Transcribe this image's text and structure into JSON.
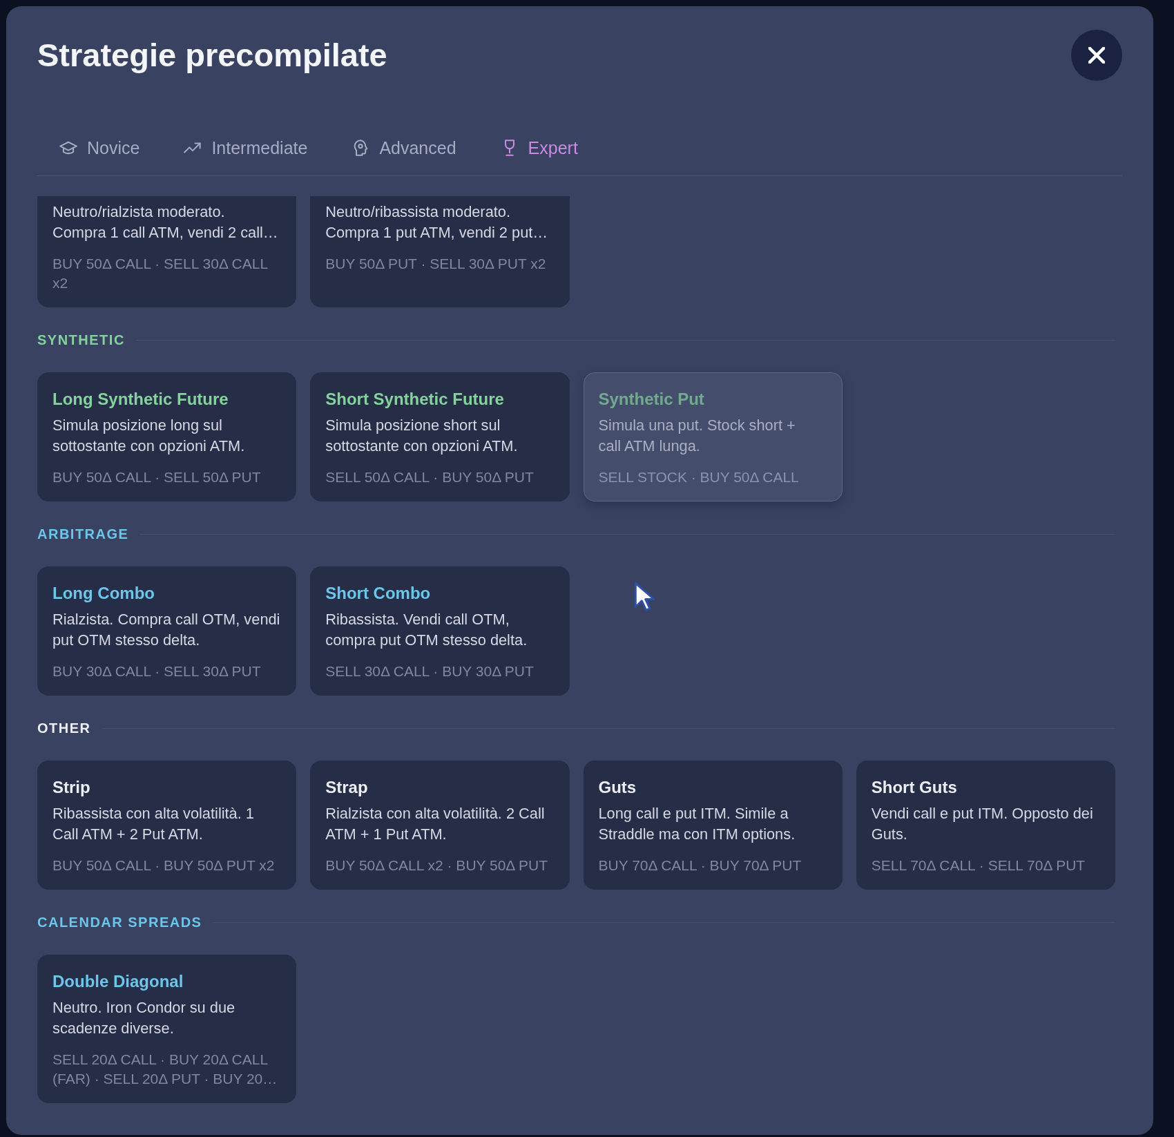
{
  "modal": {
    "title": "Strategie precompilate"
  },
  "tabs": [
    {
      "label": "Novice",
      "selected": false
    },
    {
      "label": "Intermediate",
      "selected": false
    },
    {
      "label": "Advanced",
      "selected": false
    },
    {
      "label": "Expert",
      "selected": true
    }
  ],
  "sections": [
    {
      "cards": [
        {
          "description": "Neutro/rialzista moderato. Compra 1 call ATM, vendi 2 call…",
          "legs": "BUY 50Δ CALL · SELL 30Δ CALL x2",
          "disabled": false
        },
        {
          "description": "Neutro/ribassista moderato. Compra 1 put ATM, vendi 2 put…",
          "legs": "BUY 50Δ PUT · SELL 30Δ PUT x2",
          "disabled": false
        }
      ]
    },
    {
      "label": "SYNTHETIC",
      "color": "#84d39c",
      "cards": [
        {
          "title": "Long Synthetic Future",
          "description": "Simula posizione long sul sottostante con opzioni ATM.",
          "legs": "BUY 50Δ CALL · SELL 50Δ PUT",
          "disabled": false
        },
        {
          "title": "Short Synthetic Future",
          "description": "Simula posizione short sul sottostante con opzioni ATM.",
          "legs": "SELL 50Δ CALL · BUY 50Δ PUT",
          "disabled": false
        },
        {
          "title": "Synthetic Put",
          "description": "Simula una put. Stock short + call ATM lunga.",
          "legs": "SELL STOCK · BUY 50Δ CALL",
          "disabled": true
        }
      ]
    },
    {
      "label": "ARBITRAGE",
      "color": "#6cc6ea",
      "cards": [
        {
          "title": "Long Combo",
          "description": "Rialzista. Compra call OTM, vendi put OTM stesso delta.",
          "legs": "BUY 30Δ CALL · SELL 30Δ PUT",
          "disabled": false
        },
        {
          "title": "Short Combo",
          "description": "Ribassista. Vendi call OTM, compra put OTM stesso delta.",
          "legs": "SELL 30Δ CALL · BUY 30Δ PUT",
          "disabled": false
        }
      ]
    },
    {
      "label": "OTHER",
      "color": "#eceef4",
      "cards": [
        {
          "title": "Strip",
          "description": "Ribassista con alta volatilità. 1 Call ATM + 2 Put ATM.",
          "legs": "BUY 50Δ CALL · BUY 50Δ PUT x2",
          "disabled": false
        },
        {
          "title": "Strap",
          "description": "Rialzista con alta volatilità. 2 Call ATM + 1 Put ATM.",
          "legs": "BUY 50Δ CALL x2 · BUY 50Δ PUT",
          "disabled": false
        },
        {
          "title": "Guts",
          "description": "Long call e put ITM. Simile a Straddle ma con ITM options.",
          "legs": "BUY 70Δ CALL · BUY 70Δ PUT",
          "disabled": false
        },
        {
          "title": "Short Guts",
          "description": "Vendi call e put ITM. Opposto dei Guts.",
          "legs": "SELL 70Δ CALL · SELL 70Δ PUT",
          "disabled": false
        }
      ]
    },
    {
      "label": "CALENDAR SPREADS",
      "color": "#6cc6ea",
      "cards": [
        {
          "title": "Double Diagonal",
          "description": "Neutro. Iron Condor su due scadenze diverse.",
          "legs": "SELL 20Δ CALL · BUY 20Δ CALL (FAR) · SELL 20Δ PUT · BUY 20…",
          "disabled": false
        }
      ]
    }
  ]
}
